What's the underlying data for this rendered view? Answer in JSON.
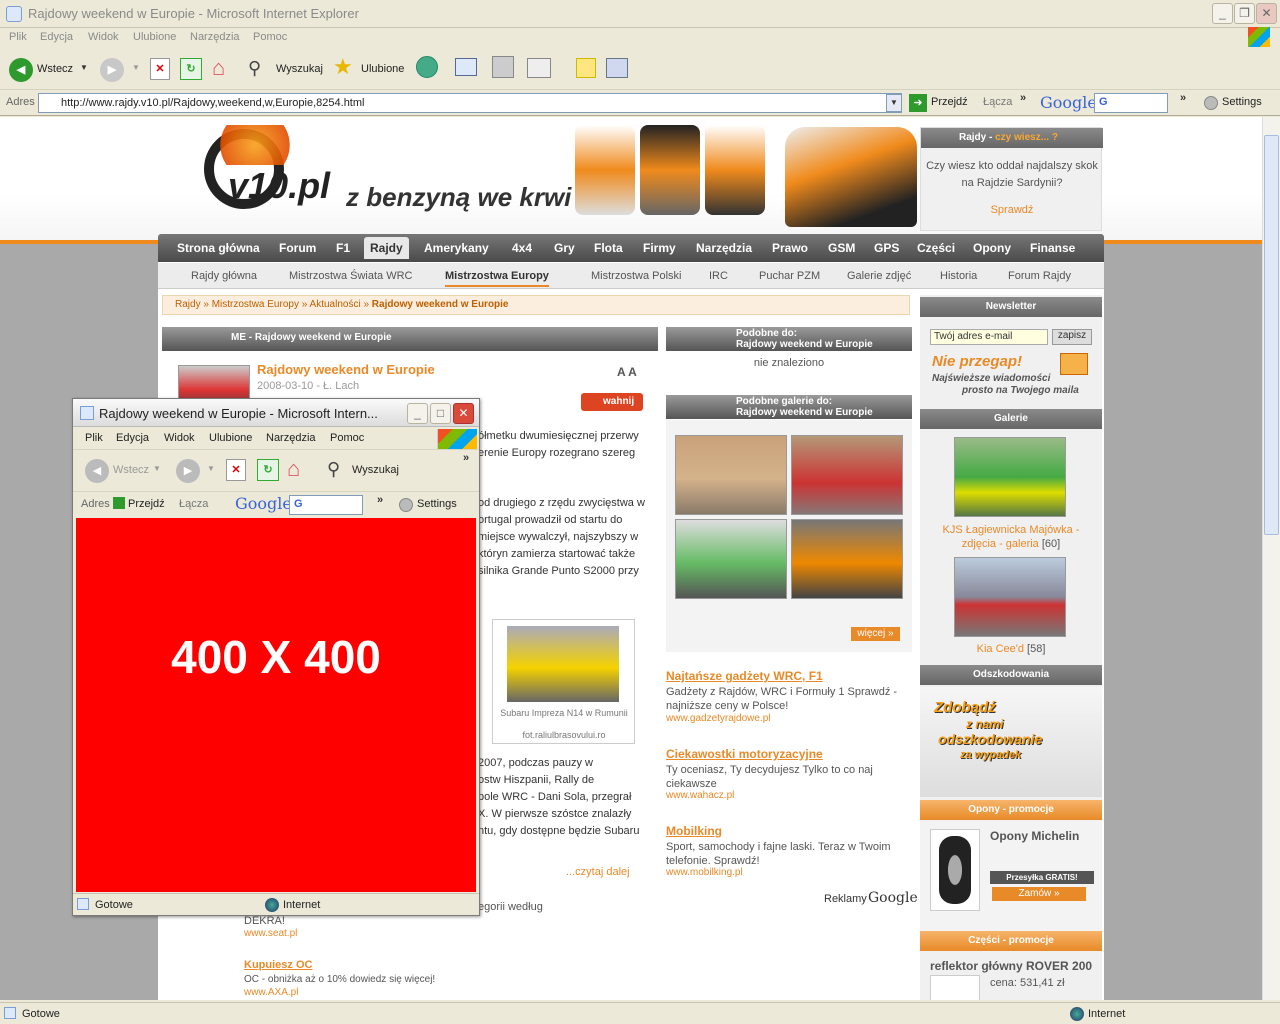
{
  "browser": {
    "title": "Rajdowy weekend w Europie - Microsoft Internet Explorer",
    "menu": [
      "Plik",
      "Edycja",
      "Widok",
      "Ulubione",
      "Narzędzia",
      "Pomoc"
    ],
    "toolbar": {
      "back": "Wstecz",
      "search": "Wyszukaj",
      "favorites": "Ulubione"
    },
    "address_label": "Adres",
    "url": "http://www.rajdy.v10.pl/Rajdowy,weekend,w,Europie,8254.html",
    "go": "Przejdź",
    "links": "Łącza",
    "google": "Google",
    "google_sel": "G",
    "settings": "Settings",
    "status": "Gotowe",
    "zone": "Internet"
  },
  "site": {
    "logo": "v10.pl",
    "tagline": "z benzyną we krwi",
    "quiz": {
      "title": "Rajdy - ",
      "title_link": "czy wiesz... ?",
      "text": "Czy wiesz kto oddał najdalszy skok na Rajdzie Sardynii?",
      "link": "Sprawdź"
    },
    "mainnav": [
      "Strona główna",
      "Forum",
      "F1",
      "Rajdy",
      "Amerykany",
      "4x4",
      "Gry",
      "Flota",
      "Firmy",
      "Narzędzia",
      "Prawo",
      "GSM",
      "GPS",
      "Części",
      "Opony",
      "Finanse"
    ],
    "subnav": [
      "Rajdy główna",
      "Mistrzostwa Świata WRC",
      "Mistrzostwa Europy",
      "Mistrzostwa Polski",
      "IRC",
      "Puchar PZM",
      "Galerie zdjęć",
      "Historia",
      "Forum Rajdy"
    ],
    "breadcrumb": {
      "a": "Rajdy",
      "b": "Mistrzostwa Europy",
      "c": "Aktualności",
      "current": "Rajdowy weekend w Europie",
      "sep": " » "
    },
    "article": {
      "box_title": "ME - Rajdowy weekend w Europie",
      "title": "Rajdowy weekend w Europie",
      "meta": "2008-03-10 - Ł. Lach",
      "font": "A A",
      "wahnij": "wahnij",
      "p1": [
        "ółmetku dwumiesięcznej przerwy",
        "erenie Europy rozegrano szereg"
      ],
      "p2": [
        "od drugiego z rzędu zwycięstwa w",
        "ortugal prowadził od startu do",
        "miejsce wywalczył, najszybszy w",
        "któryn zamierza startować także",
        "silnika Grande Punto S2000 przy"
      ],
      "photo_caption": "Subaru Impreza N14 w Rumunii",
      "photo_credit": "fot.raliulbrasovului.ro",
      "p3": [
        "2007, podczas pauzy w",
        "ostw Hiszpanii, Rally de",
        "pole WRC - Dani Sola, przegrał",
        "X. W pierwsze szóstce znalazły",
        "ntu, gdy dostępne będzie Subaru"
      ],
      "more": "...czytaj dalej",
      "tail1": "egorii według",
      "tail2": "DEKRA!",
      "ad_url1": "www.seat.pl",
      "ad2_title": "Kupuiesz OC",
      "ad2_text": "OC - obniżka aż o 10% dowiedz się więcej!",
      "ad2_url": "www.AXA.pl"
    },
    "similar": {
      "head1": "Podobne do:",
      "head2": "Rajdowy weekend w Europie",
      "none": "nie znaleziono"
    },
    "galleries": {
      "head1": "Podobne galerie do:",
      "head2": "Rajdowy weekend w Europie",
      "more": "więcej »"
    },
    "ads": [
      {
        "title": "Najtańsze gadżety WRC, F1",
        "text": "Gadżety z Rajdów, WRC i Formuły 1 Sprawdź - najniższe ceny w Polsce!",
        "url": "www.gadzetyrajdowe.pl"
      },
      {
        "title": "Ciekawostki motoryzacyjne",
        "text": "Ty oceniasz, Ty decydujesz Tylko to co naj ciekawsze",
        "url": "www.wahacz.pl"
      },
      {
        "title": "Mobilking",
        "text": "Sport, samochody i fajne laski. Teraz w Twoim telefonie. Sprawdź!",
        "url": "www.mobilking.pl"
      }
    ],
    "ads_label": "Reklamy",
    "ads_google": "Google",
    "sidebar": {
      "newsletter": "Newsletter",
      "email_placeholder": "Twój adres e-mail",
      "submit": "zapisz",
      "np1": "Nie przegap!",
      "np2": "Najświeższe wiadomości",
      "np3": "prosto na Twojego maila",
      "galerie": "Galerie",
      "g1": "KJS Łagiewnicka Majówka - zdjęcia - galeria",
      "g1n": "[60]",
      "g2": "Kia Cee'd",
      "g2n": "[58]",
      "odsz": "Odszkodowania",
      "odsz_ad": [
        "Zdobądź",
        "z nami",
        "odszkodowanie",
        "za wypadek"
      ],
      "opony_h": "Opony - promocje",
      "opony_t": "Opony Michelin",
      "opony_free": "Przesyłka GRATIS!",
      "opony_btn": "Zamów »",
      "czesci_h": "Części - promocje",
      "czesci_t": "reflektor główny ROVER 200",
      "czesci_p": "cena: 531,41 zł"
    }
  },
  "popup": {
    "title": "Rajdowy weekend w Europie - Microsoft Intern...",
    "menu": [
      "Plik",
      "Edycja",
      "Widok",
      "Ulubione",
      "Narzędzia",
      "Pomoc"
    ],
    "back": "Wstecz",
    "search": "Wyszukaj",
    "address": "Adres",
    "go": "Przejdź",
    "links": "Łącza",
    "google": "Google",
    "google_sel": "G",
    "settings": "Settings",
    "ad": "400 X 400",
    "status": "Gotowe",
    "zone": "Internet"
  }
}
